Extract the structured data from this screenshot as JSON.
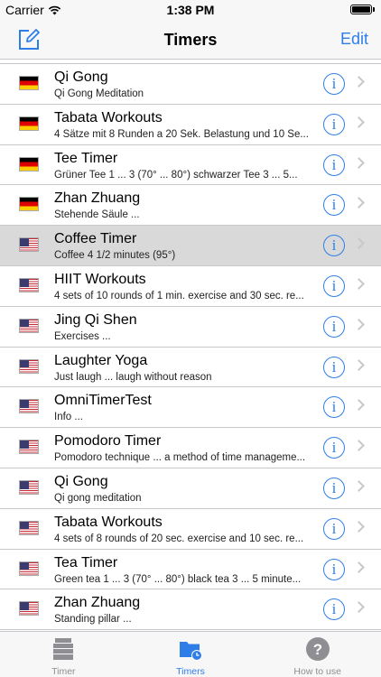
{
  "status_bar": {
    "carrier": "Carrier",
    "time": "1:38 PM"
  },
  "nav": {
    "title": "Timers",
    "edit_label": "Edit"
  },
  "timers": [
    {
      "flag": "de",
      "title": "Qi Gong",
      "subtitle": "Qi Gong Meditation"
    },
    {
      "flag": "de",
      "title": "Tabata Workouts",
      "subtitle": "4 Sätze mit 8 Runden a 20 Sek. Belastung und 10 Se..."
    },
    {
      "flag": "de",
      "title": "Tee Timer",
      "subtitle": "Grüner Tee  1 ... 3 (70° ... 80°) schwarzer Tee 3 ... 5..."
    },
    {
      "flag": "de",
      "title": "Zhan Zhuang",
      "subtitle": "Stehende Säule ..."
    },
    {
      "flag": "us",
      "title": "Coffee Timer",
      "subtitle": "Coffee 4 1/2 minutes (95°)",
      "selected": true
    },
    {
      "flag": "us",
      "title": "HIIT Workouts",
      "subtitle": "4 sets of 10 rounds of 1 min. exercise and 30 sec. re..."
    },
    {
      "flag": "us",
      "title": "Jing Qi Shen",
      "subtitle": "Exercises ..."
    },
    {
      "flag": "us",
      "title": "Laughter Yoga",
      "subtitle": "Just laugh ... laugh without reason"
    },
    {
      "flag": "us",
      "title": "OmniTimerTest",
      "subtitle": "Info ..."
    },
    {
      "flag": "us",
      "title": "Pomodoro Timer",
      "subtitle": "Pomodoro technique ... a method of time manageme..."
    },
    {
      "flag": "us",
      "title": "Qi Gong",
      "subtitle": "Qi gong meditation"
    },
    {
      "flag": "us",
      "title": "Tabata Workouts",
      "subtitle": "4 sets of 8 rounds of 20 sec. exercise and 10 sec. re..."
    },
    {
      "flag": "us",
      "title": "Tea Timer",
      "subtitle": "Green tea 1 ... 3 (70° ... 80°) black tea 3 ... 5 minute..."
    },
    {
      "flag": "us",
      "title": "Zhan Zhuang",
      "subtitle": "Standing pillar ..."
    }
  ],
  "tabs": [
    {
      "label": "Timer",
      "icon": "timer-stack-icon",
      "active": false
    },
    {
      "label": "Timers",
      "icon": "timers-folder-icon",
      "active": true
    },
    {
      "label": "How to use",
      "icon": "help-icon",
      "active": false
    }
  ],
  "colors": {
    "accent": "#2f7ee8",
    "selected_row": "#d9d9d9",
    "inactive_tab": "#8e8e93"
  }
}
